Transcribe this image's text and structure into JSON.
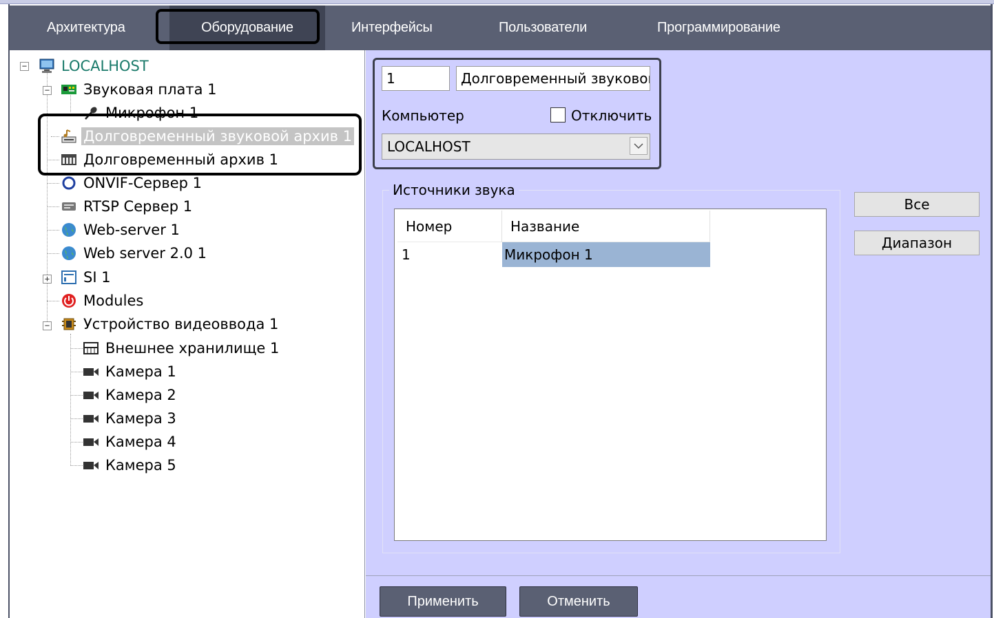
{
  "tabs": [
    {
      "label": "Архитектура"
    },
    {
      "label": "Оборудование"
    },
    {
      "label": "Интерфейсы"
    },
    {
      "label": "Пользователи"
    },
    {
      "label": "Программирование"
    }
  ],
  "tree": {
    "root": {
      "label": "LOCALHOST",
      "icon": "computer-icon"
    },
    "items": [
      {
        "label": "Звуковая плата 1",
        "icon": "sound-card-icon"
      },
      {
        "label": "Микрофон 1",
        "icon": "microphone-icon"
      },
      {
        "label": "Долговременный звуковой архив 1",
        "icon": "sound-archive-icon",
        "selected": true
      },
      {
        "label": "Долговременный архив 1",
        "icon": "archive-icon"
      },
      {
        "label": "ONVIF-Сервер 1",
        "icon": "onvif-icon"
      },
      {
        "label": "RTSP Сервер 1",
        "icon": "rtsp-icon"
      },
      {
        "label": "Web-server 1",
        "icon": "globe-icon"
      },
      {
        "label": "Web server 2.0 1",
        "icon": "globe-icon"
      },
      {
        "label": "SI 1",
        "icon": "si-icon"
      },
      {
        "label": "Modules",
        "icon": "power-icon"
      },
      {
        "label": "Устройство видеоввода 1",
        "icon": "video-capture-icon"
      },
      {
        "label": "Внешнее хранилище 1",
        "icon": "storage-icon"
      },
      {
        "label": "Камера 1",
        "icon": "camera-icon"
      },
      {
        "label": "Камера 2",
        "icon": "camera-icon"
      },
      {
        "label": "Камера 3",
        "icon": "camera-icon"
      },
      {
        "label": "Камера 4",
        "icon": "camera-icon"
      },
      {
        "label": "Камера 5",
        "icon": "camera-icon"
      }
    ]
  },
  "props": {
    "id_value": "1",
    "name_value": "Долговременный звуковой",
    "computer_label": "Компьютер",
    "disable_label": "Отключить",
    "computer_value": "LOCALHOST"
  },
  "sources": {
    "title": "Источники звука",
    "columns": [
      "Номер",
      "Название"
    ],
    "rows": [
      {
        "num": "1",
        "name": "Микрофон 1"
      }
    ]
  },
  "buttons": {
    "all": "Все",
    "range": "Диапазон",
    "apply": "Применить",
    "cancel": "Отменить"
  },
  "colors": {
    "tab_bar": "#5a6073",
    "panel_bg": "#cfcfff",
    "row_select": "#9ab4d4"
  }
}
